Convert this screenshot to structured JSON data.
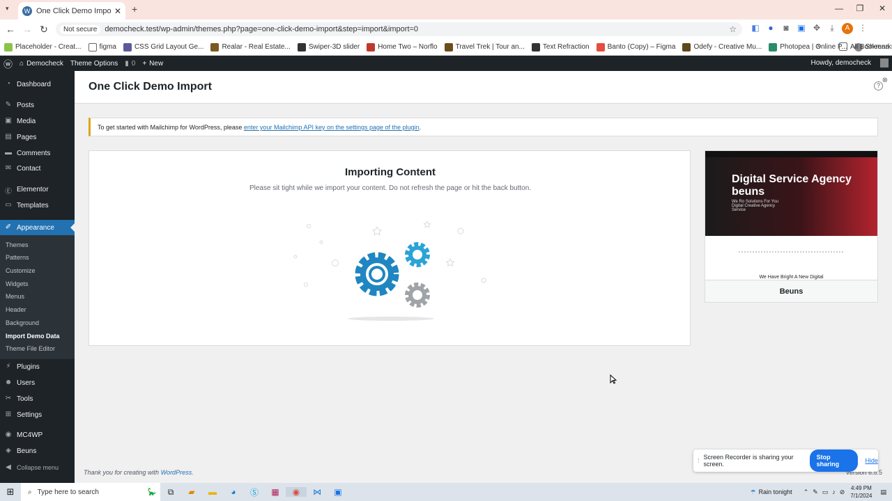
{
  "browser": {
    "tab_title": "One Click Demo Import ‹ Demo",
    "not_secure": "Not secure",
    "url": "democheck.test/wp-admin/themes.php?page=one-click-demo-import&step=import&import=0",
    "bookmarks": [
      "Placeholder - Creat...",
      "figma",
      "CSS Grid Layout Ge...",
      "Realar - Real Estate...",
      "Swiper-3D slider",
      "Home Two – Norflo",
      "Travel Trek | Tour an...",
      "Text Refraction",
      "Banto (Copy) – Figma",
      "Odefy - Creative Mu...",
      "Photopea | Online P...",
      "Sheena Site – Your..."
    ],
    "all_bookmarks": "All Bookmarks",
    "profile_initial": "A"
  },
  "adminbar": {
    "site": "Democheck",
    "theme_options": "Theme Options",
    "comments_count": "0",
    "new": "New",
    "howdy": "Howdy, democheck"
  },
  "sidebar": {
    "items": [
      "Dashboard",
      "Posts",
      "Media",
      "Pages",
      "Comments",
      "Contact",
      "Elementor",
      "Templates",
      "Appearance",
      "Plugins",
      "Users",
      "Tools",
      "Settings",
      "MC4WP",
      "Beuns",
      "Collapse menu"
    ],
    "appearance_sub": [
      "Themes",
      "Patterns",
      "Customize",
      "Widgets",
      "Menus",
      "Header",
      "Background",
      "Import Demo Data",
      "Theme File Editor"
    ]
  },
  "page": {
    "title": "One Click Demo Import",
    "notice_text": "To get started with Mailchimp for WordPress, please ",
    "notice_link": "enter your Mailchimp API key on the settings page of the plugin",
    "notice_end": ".",
    "import_title": "Importing Content",
    "import_desc": "Please sit tight while we import your content. Do not refresh the page or hit the back button.",
    "theme_hero_title": "Digital Service Agency beuns",
    "theme_hero_sub": "We Ro Solutions For You Digital Creative Agency Service",
    "theme_tagline": "We Have Bright A New Digital",
    "theme_name": "Beuns",
    "footer_text": "Thank you for creating with ",
    "footer_link": "WordPress",
    "footer_end": ".",
    "version": "Version 6.5.5"
  },
  "sharebar": {
    "message": "Screen Recorder is sharing your screen.",
    "stop": "Stop sharing",
    "hide": "Hide"
  },
  "taskbar": {
    "search_placeholder": "Type here to search",
    "weather": "Rain tonight",
    "time": "4:49 PM",
    "date": "7/1/2024"
  },
  "colors": {
    "accent": "#2271b1",
    "adminbar": "#1d2327",
    "gear_blue": "#1f86c1",
    "gear_grey": "#a0a4a8"
  }
}
